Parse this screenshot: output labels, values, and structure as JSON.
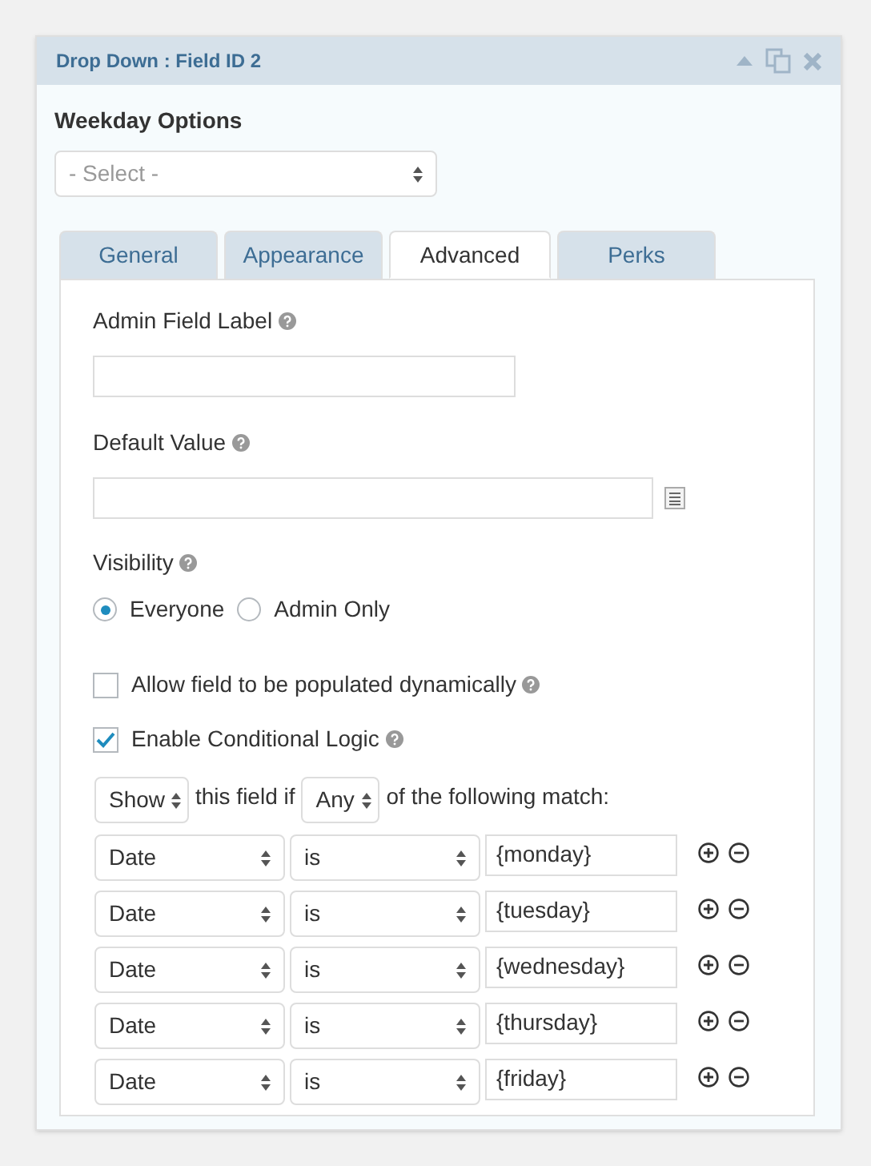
{
  "header": {
    "title": "Drop Down : Field ID 2"
  },
  "field": {
    "label": "Weekday Options",
    "select": "- Select -"
  },
  "tabs": [
    {
      "label": "General",
      "selected": false
    },
    {
      "label": "Appearance",
      "selected": false
    },
    {
      "label": "Advanced",
      "selected": true
    },
    {
      "label": "Perks",
      "selected": false
    }
  ],
  "admin_label": {
    "label": "Admin Field Label"
  },
  "default_value": {
    "label": "Default Value"
  },
  "visibility": {
    "label": "Visibility",
    "options": [
      {
        "label": "Everyone",
        "selected": true
      },
      {
        "label": "Admin Only",
        "selected": false
      }
    ]
  },
  "checkboxes": [
    {
      "label": "Allow field to be populated dynamically",
      "checked": false
    },
    {
      "label": "Enable Conditional Logic",
      "checked": true
    }
  ],
  "logic": {
    "action": "Show",
    "text_1": "this field if",
    "match": "Any",
    "text_2": "of the following match:"
  },
  "rules": [
    {
      "field": "Date",
      "operator": "is",
      "value": "{monday}"
    },
    {
      "field": "Date",
      "operator": "is",
      "value": "{tuesday}"
    },
    {
      "field": "Date",
      "operator": "is",
      "value": "{wednesday}"
    },
    {
      "field": "Date",
      "operator": "is",
      "value": "{thursday}"
    },
    {
      "field": "Date",
      "operator": "is",
      "value": "{friday}"
    }
  ]
}
